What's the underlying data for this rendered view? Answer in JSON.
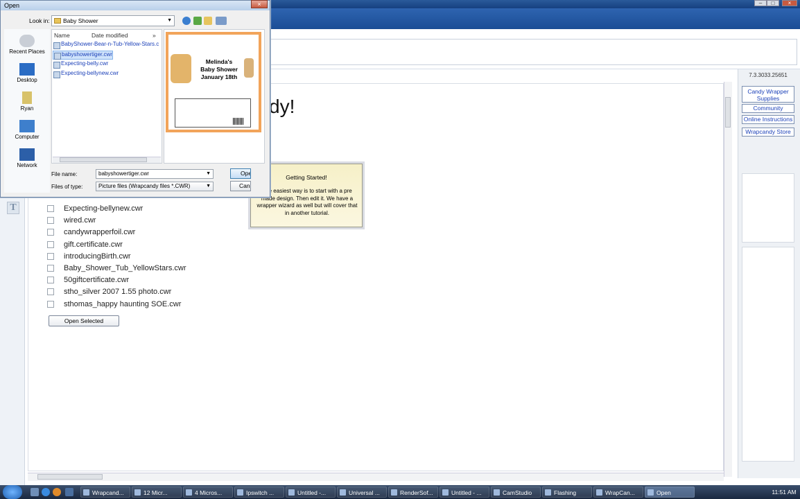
{
  "main": {
    "heading_fragment": "dy!",
    "tool_label": "T",
    "files": [
      "Expecting-bellynew.cwr",
      "wired.cwr",
      "candywrapperfoil.cwr",
      "gift.certificate.cwr",
      "introducingBirth.cwr",
      "Baby_Shower_Tub_YellowStars.cwr",
      "50giftcertificate.cwr",
      "stho_silver 2007 1.55 photo.cwr",
      "sthomas_happy haunting SOE.cwr"
    ],
    "open_selected_label": "Open Selected"
  },
  "right_panel": {
    "version": "7.3.3033.25651",
    "links": [
      "Candy Wrapper Supplies",
      "Community",
      "Online Instructions",
      "Wrapcandy Store"
    ]
  },
  "tooltip": {
    "title": "Getting Started!",
    "body": "The easiest way is to start with a pre made design.  Then edit it. We have a wrapper wizard as well but will cover that in another tutorial."
  },
  "dialog": {
    "title": "Open",
    "look_in_label": "Look in:",
    "look_in_value": "Baby Shower",
    "places": [
      "Recent Places",
      "Desktop",
      "Ryan",
      "Computer",
      "Network"
    ],
    "columns": {
      "name": "Name",
      "date": "Date modified",
      "more": "»"
    },
    "files": [
      "BabyShower-Bear-n-Tub-Yellow-Stars.c",
      "babyshowertiger.cwr",
      "Expecting-belly.cwr",
      "Expecting-bellynew.cwr"
    ],
    "selected_file": "babyshowertiger.cwr",
    "preview": {
      "line1": "Melinda's",
      "line2": "Baby Shower",
      "line3": "January 18th"
    },
    "file_name_label": "File name:",
    "file_name_value": "babyshowertiger.cwr",
    "file_type_label": "Files of type:",
    "file_type_value": "Picture files (Wrapcandy files *.CWR)",
    "open_label": "Open",
    "cancel_label": "Cancel"
  },
  "taskbar": {
    "items": [
      "Wrapcand...",
      "12 Micr...",
      "4 Micros...",
      "Ipswitch ...",
      "Untitled -...",
      "Universal ...",
      "RenderSof...",
      "Untitled - ...",
      "CamStudio",
      "Flashing",
      "WrapCan...",
      "Open"
    ],
    "active": "Open",
    "clock": "11:51 AM"
  },
  "colors": {
    "accent": "#1a3fb8",
    "tooltip_bg": "#f6f0c8",
    "preview_border": "#f2a45a"
  }
}
